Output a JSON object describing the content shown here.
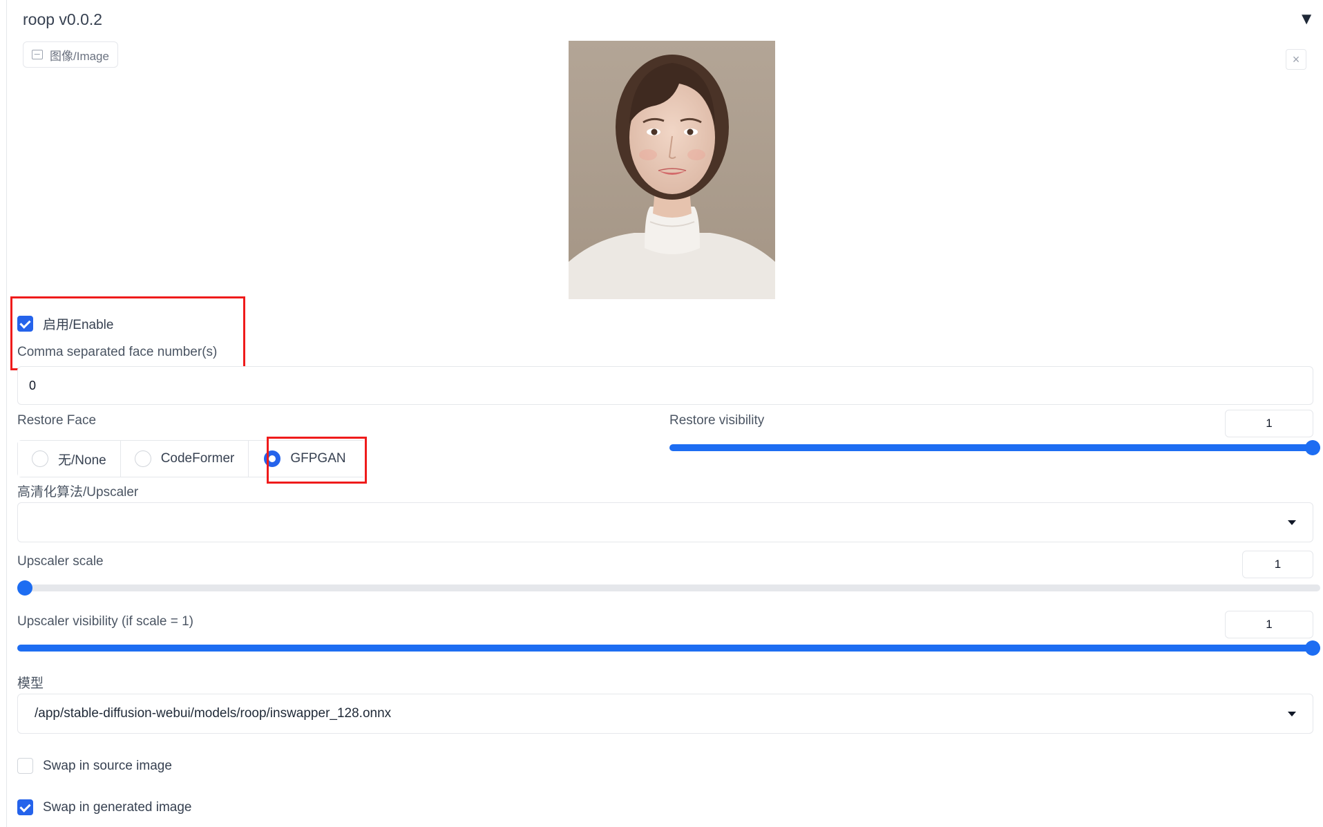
{
  "header": {
    "title": "roop v0.0.2",
    "collapse_glyph": "▼"
  },
  "image_tab": {
    "label": "图像/Image",
    "icon": "image-icon"
  },
  "close_glyph": "×",
  "enable": {
    "label": "启用/Enable",
    "checked": true
  },
  "face_numbers": {
    "label": "Comma separated face number(s)",
    "value": "0"
  },
  "restore_face": {
    "label": "Restore Face",
    "options": [
      "无/None",
      "CodeFormer",
      "GFPGAN"
    ],
    "selected": "GFPGAN"
  },
  "restore_visibility": {
    "label": "Restore visibility",
    "value": "1",
    "fraction": 1.0
  },
  "upscaler": {
    "label": "高清化算法/Upscaler",
    "value": ""
  },
  "upscaler_scale": {
    "label": "Upscaler scale",
    "value": "1",
    "fraction": 0.0
  },
  "upscaler_visibility": {
    "label": "Upscaler visibility (if scale = 1)",
    "value": "1",
    "fraction": 1.0
  },
  "model": {
    "label": "模型",
    "value": "/app/stable-diffusion-webui/models/roop/inswapper_128.onnx"
  },
  "swap_source": {
    "label": "Swap in source image",
    "checked": false
  },
  "swap_generated": {
    "label": "Swap in generated image",
    "checked": true
  },
  "colors": {
    "accent": "#2563eb",
    "highlight": "#ef1b1b"
  }
}
